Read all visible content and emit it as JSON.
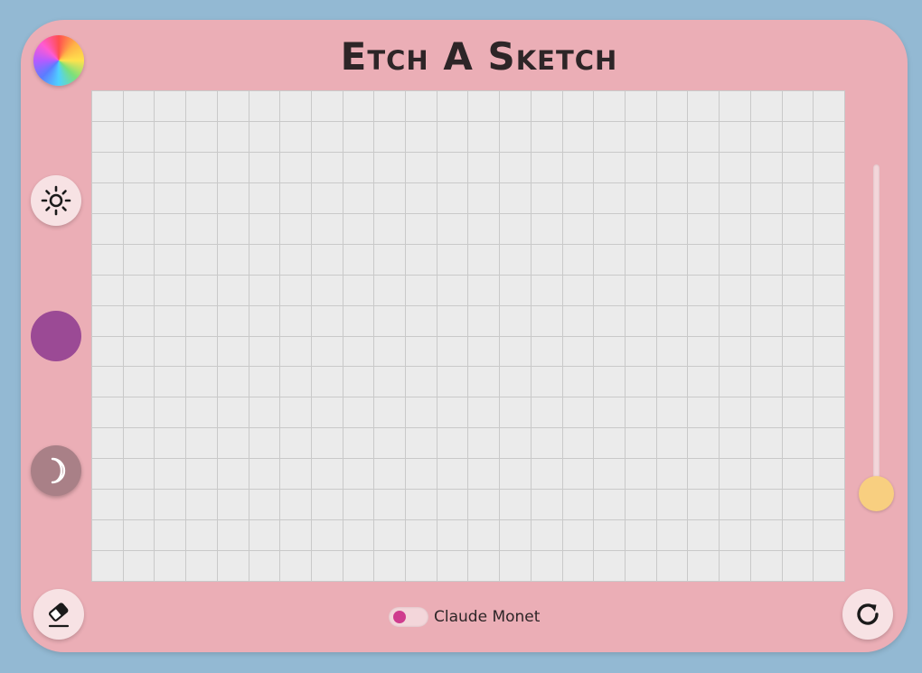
{
  "app": {
    "title": "Etch A Sketch"
  },
  "grid": {
    "columns": 24,
    "rows": 16,
    "cell_color": "#ebebeb",
    "line_color": "#c9c9c9"
  },
  "tools": {
    "rainbow_icon": "rainbow-wheel-icon",
    "sun_icon": "sun-icon",
    "moon_icon": "moon-icon",
    "eraser_icon": "eraser-icon",
    "refresh_icon": "refresh-icon",
    "selected_color": "#9b4a95"
  },
  "size_slider": {
    "value_fraction": 0.94
  },
  "mode_toggle": {
    "label": "Claude Monet",
    "enabled": true
  },
  "colors": {
    "background": "#93b9d3",
    "frame": "#ebaeb6",
    "slider_thumb": "#f8cf80",
    "toggle_knob": "#cf3c8e"
  }
}
